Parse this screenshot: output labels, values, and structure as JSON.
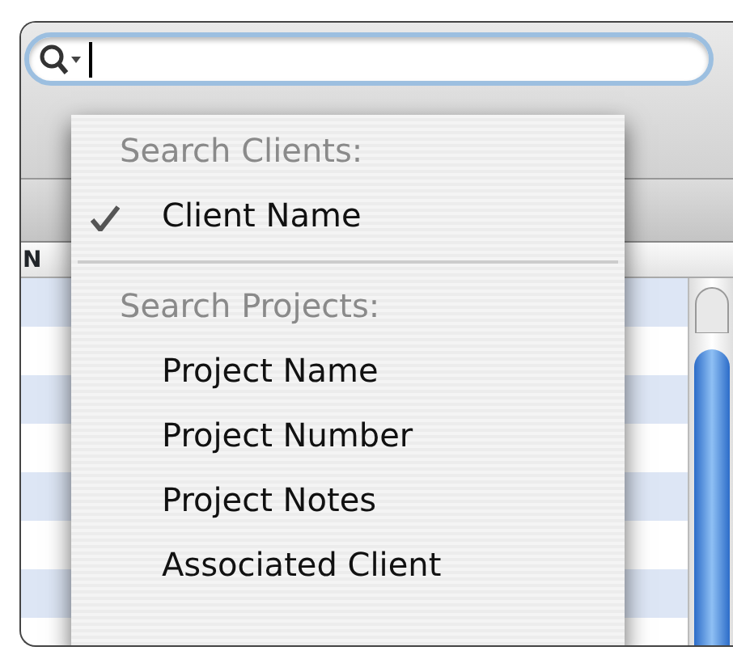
{
  "table": {
    "columns": [
      "N"
    ]
  },
  "menu": {
    "sections": [
      {
        "title": "Search Clients:",
        "items": [
          {
            "label": "Client Name",
            "checked": true
          }
        ]
      },
      {
        "title": "Search Projects:",
        "items": [
          {
            "label": "Project Name",
            "checked": false
          },
          {
            "label": "Project Number",
            "checked": false
          },
          {
            "label": "Project Notes",
            "checked": false
          },
          {
            "label": "Associated Client",
            "checked": false
          }
        ]
      }
    ]
  }
}
